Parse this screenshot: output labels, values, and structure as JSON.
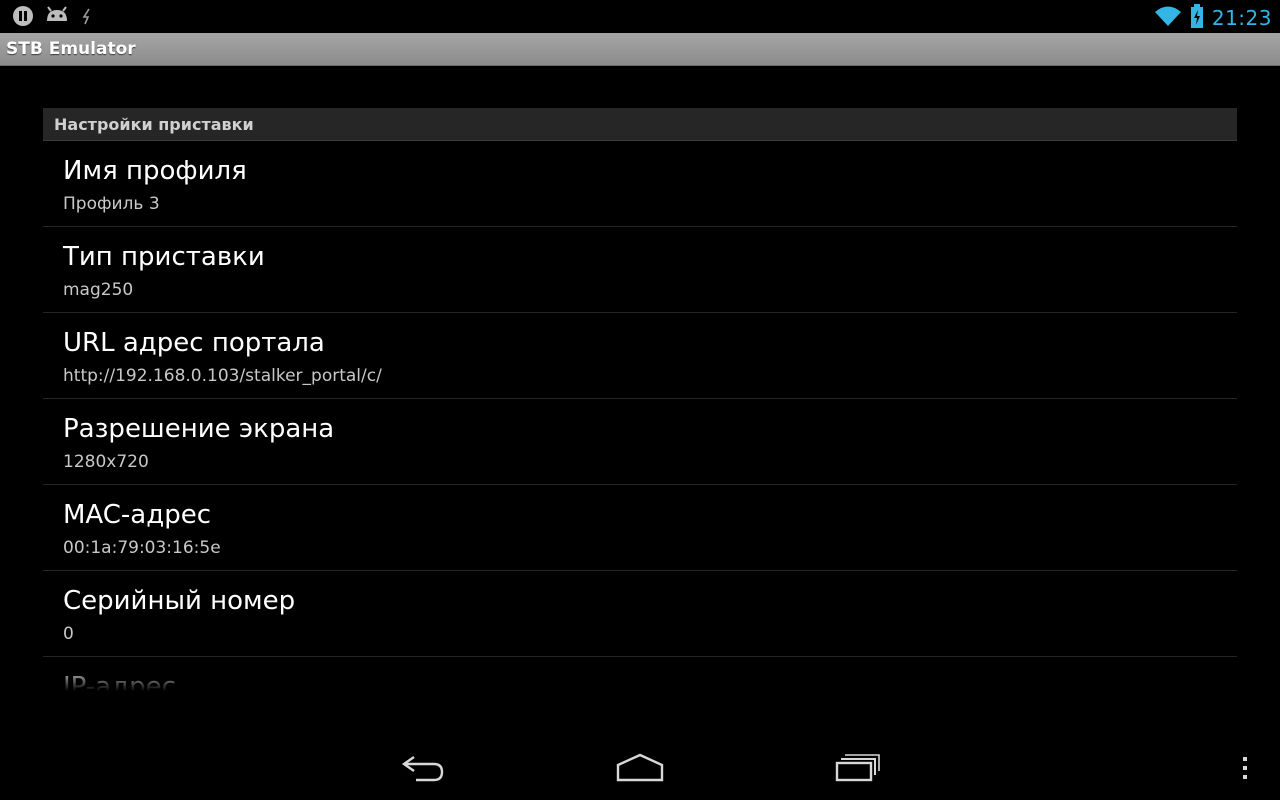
{
  "status_bar": {
    "time": "21:23",
    "colors": {
      "time": "#33b5e5",
      "wifi": "#33b5e5",
      "battery": "#33b5e5"
    },
    "icons": [
      "pause-icon",
      "android-icon",
      "usb-debug-icon",
      "wifi-icon",
      "battery-charging-icon"
    ]
  },
  "app": {
    "title": "STB Emulator"
  },
  "settings": {
    "category": "Настройки приставки",
    "items": [
      {
        "title": "Имя профиля",
        "summary": "Профиль 3"
      },
      {
        "title": "Тип приставки",
        "summary": "mag250"
      },
      {
        "title": "URL адрес портала",
        "summary": "http://192.168.0.103/stalker_portal/c/"
      },
      {
        "title": "Разрешение экрана",
        "summary": "1280x720"
      },
      {
        "title": "MAC-адрес",
        "summary": "00:1a:79:03:16:5e"
      },
      {
        "title": "Серийный номер",
        "summary": "0"
      },
      {
        "title": "IP-адрес",
        "summary": ""
      }
    ]
  },
  "nav_bar": {
    "icons": [
      "back-icon",
      "home-icon",
      "recent-apps-icon",
      "overflow-menu-icon"
    ]
  }
}
